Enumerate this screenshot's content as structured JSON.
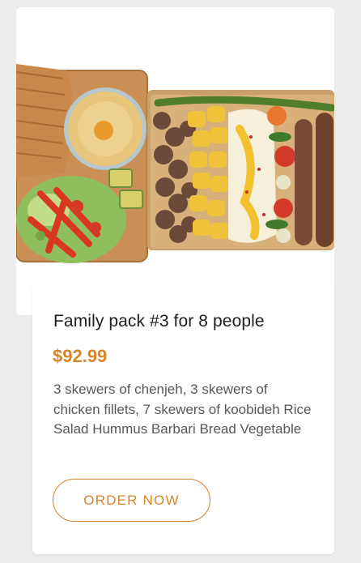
{
  "product": {
    "title": "Family pack #3 for 8 people",
    "price": "$92.99",
    "description": "3 skewers of chenjeh, 3 skewers of chicken fillets, 7 skewers of koobideh Rice Salad Hummus Barbari Bread Vegetable",
    "order_label": "ORDER NOW",
    "image_icon": "food-platter-image"
  },
  "colors": {
    "accent": "#d98428",
    "title": "#1e1e1e",
    "text": "#575757",
    "background": "#ececec",
    "card": "#ffffff"
  }
}
